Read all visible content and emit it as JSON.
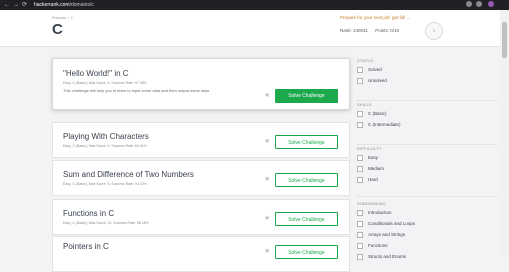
{
  "browser": {
    "back": "←",
    "forward": "→",
    "reload": "⟳",
    "url_host": "hackerrank.com",
    "url_path": "/domains/c",
    "url_scheme": ""
  },
  "header": {
    "breadcrumb": "Prepare > C",
    "title": "C",
    "prompt": "Prepare for your next job: get full ...",
    "rank": "Rank: 440031",
    "points": "Points: 0/10",
    "avatar_text": "0"
  },
  "challenges": [
    {
      "title": "\"Hello World!\" in C",
      "meta": "Easy, C (Basic), Max Score: 5, Success Rate: 97.35%",
      "desc": "This challenge will help you to learn to input some data and then output some data.",
      "button": "Solve Challenge",
      "featured": true
    },
    {
      "title": "Playing With Characters",
      "meta": "Easy, C (Basic), Max Score: 5, Success Rate: 84.31%",
      "desc": "",
      "button": "Solve Challenge",
      "featured": false
    },
    {
      "title": "Sum and Difference of Two Numbers",
      "meta": "Easy, C (Basic), Max Score: 5, Success Rate: 94.42%",
      "desc": "",
      "button": "Solve Challenge",
      "featured": false
    },
    {
      "title": "Functions in C",
      "meta": "Easy, C (Basic), Max Score: 10, Success Rate: 96.18%",
      "desc": "",
      "button": "Solve Challenge",
      "featured": false
    },
    {
      "title": "Pointers in C",
      "meta": "",
      "desc": "",
      "button": "Solve Challenge",
      "featured": false
    }
  ],
  "sidebar": {
    "status": {
      "heading": "STATUS",
      "items": [
        "Solved",
        "Unsolved"
      ]
    },
    "skills": {
      "heading": "SKILLS",
      "items": [
        "C (Basic)",
        "C (Intermediate)"
      ]
    },
    "difficulty": {
      "heading": "DIFFICULTY",
      "items": [
        "Easy",
        "Medium",
        "Hard"
      ]
    },
    "subdomains": {
      "heading": "SUBDOMAINS",
      "items": [
        "Introduction",
        "Conditionals and Loops",
        "Arrays and Strings",
        "Functions",
        "Structs and Enums"
      ]
    }
  },
  "colors": {
    "accent_green": "#1ba94c",
    "title_text": "#39424e",
    "prompt_orange": "#c77d26"
  }
}
